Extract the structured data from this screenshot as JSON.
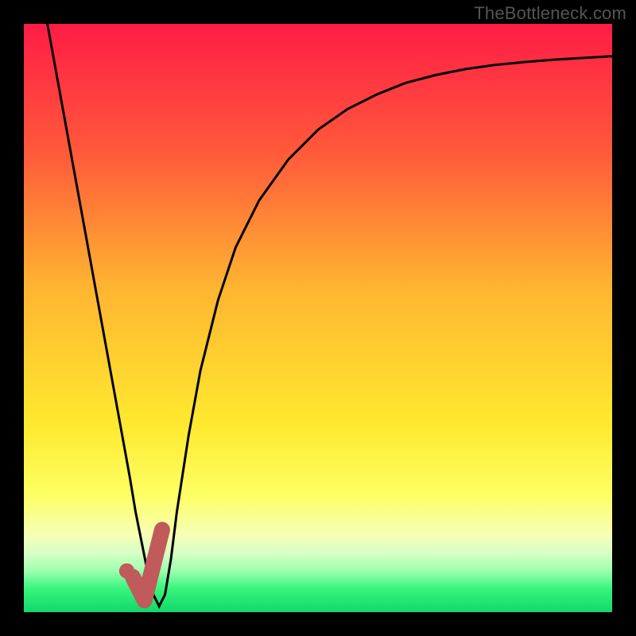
{
  "attribution": "TheBottleneck.com",
  "chart_data": {
    "type": "line",
    "title": "",
    "xlabel": "",
    "ylabel": "",
    "xlim": [
      0,
      100
    ],
    "ylim": [
      0,
      100
    ],
    "gradient_stops": [
      {
        "offset": 0,
        "color": "#ff1c46"
      },
      {
        "offset": 22,
        "color": "#ff5a3a"
      },
      {
        "offset": 45,
        "color": "#ffb531"
      },
      {
        "offset": 68,
        "color": "#ffe92f"
      },
      {
        "offset": 80,
        "color": "#fdff63"
      },
      {
        "offset": 87,
        "color": "#f6ffb6"
      },
      {
        "offset": 90,
        "color": "#d7ffc4"
      },
      {
        "offset": 93,
        "color": "#9dffb0"
      },
      {
        "offset": 96,
        "color": "#38f57d"
      },
      {
        "offset": 100,
        "color": "#11d86a"
      }
    ],
    "series": [
      {
        "name": "bottleneck-curve",
        "stroke": "#000000",
        "stroke_width": 3,
        "x": [
          4,
          6,
          8,
          10,
          12,
          14,
          16,
          18,
          19,
          20,
          21,
          22,
          23,
          24,
          25,
          26,
          28,
          30,
          33,
          36,
          40,
          45,
          50,
          55,
          60,
          65,
          70,
          75,
          80,
          85,
          90,
          95,
          100
        ],
        "y": [
          100,
          89,
          78,
          67,
          56,
          45,
          34,
          23,
          17,
          12,
          7,
          3,
          1,
          3,
          9,
          17,
          30,
          41,
          53,
          62,
          70,
          77,
          82,
          85.5,
          88,
          90,
          91.3,
          92.3,
          93,
          93.5,
          93.9,
          94.2,
          94.5
        ]
      },
      {
        "name": "highlight-check",
        "stroke": "#c15a5a",
        "stroke_width": 20,
        "linecap": "round",
        "x": [
          18.5,
          20.5,
          23.5
        ],
        "y": [
          6,
          2,
          14
        ]
      }
    ],
    "marker": {
      "name": "highlight-dot",
      "x": 17.5,
      "y": 7,
      "r": 1.3,
      "fill": "#c15a5a"
    }
  }
}
